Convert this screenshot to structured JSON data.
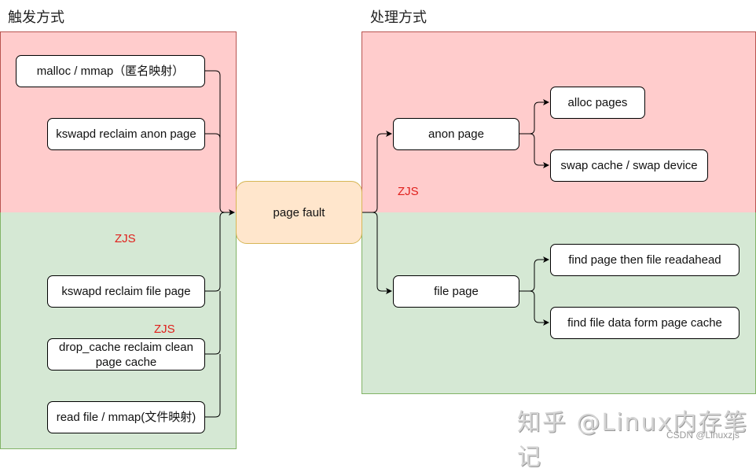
{
  "headings": {
    "trigger": "触发方式",
    "handle": "处理方式"
  },
  "trigger_nodes": [
    {
      "label": "malloc / mmap（匿名映射）"
    },
    {
      "label": "kswapd reclaim anon page"
    },
    {
      "label": "kswapd reclaim file page"
    },
    {
      "label": "drop_cache reclaim clean page cache"
    },
    {
      "label": "read file /  mmap(文件映射)"
    }
  ],
  "center_node": {
    "label": "page fault"
  },
  "handle_nodes": {
    "anon": {
      "label": "anon page"
    },
    "alloc": {
      "label": "alloc pages"
    },
    "swap": {
      "label": "swap cache / swap device"
    },
    "file": {
      "label": "file page"
    },
    "readahead": {
      "label": "find page then file readahead"
    },
    "pagecache": {
      "label": "find file data form page cache"
    }
  },
  "annotations": [
    "ZJS",
    "ZJS",
    "ZJS"
  ],
  "watermark": {
    "main": "知乎 @Linux内存笔记",
    "sub": "CSDN @Linuxzjs"
  },
  "colors": {
    "anon_region": "#ffcccc",
    "file_region": "#d5e8d4",
    "page_fault": "#ffe6cc",
    "annotation": "#e0201c"
  }
}
